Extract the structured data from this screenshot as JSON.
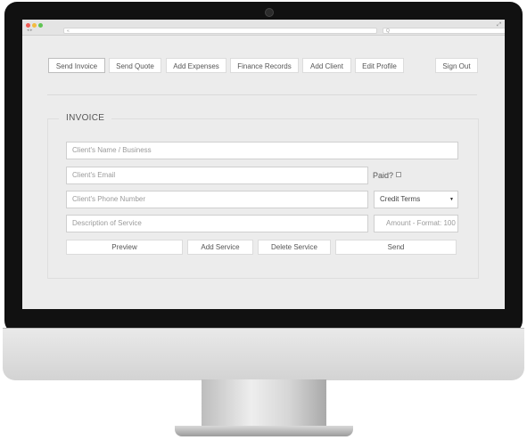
{
  "browser": {
    "url_text": "«",
    "search_text": "Q",
    "traffic_lights": [
      "#ee5b55",
      "#f3bb3e",
      "#5fc453"
    ]
  },
  "nav": {
    "send_invoice": "Send Invoice",
    "send_quote": "Send Quote",
    "add_expenses": "Add Expenses",
    "finance_records": "Finance Records",
    "add_client": "Add Client",
    "edit_profile": "Edit Profile",
    "sign_out": "Sign Out"
  },
  "invoice": {
    "legend": "INVOICE",
    "client_name_placeholder": "Client's Name / Business",
    "client_email_placeholder": "Client's Email",
    "paid_label": "Paid?",
    "paid_checked": false,
    "phone_placeholder": "Client's Phone Number",
    "credit_terms_selected": "Credit Terms",
    "description_placeholder": "Description of Service",
    "amount_placeholder": "Amount - Format: 100",
    "preview_label": "Preview",
    "add_service_label": "Add Service",
    "delete_service_label": "Delete Service",
    "send_label": "Send"
  }
}
